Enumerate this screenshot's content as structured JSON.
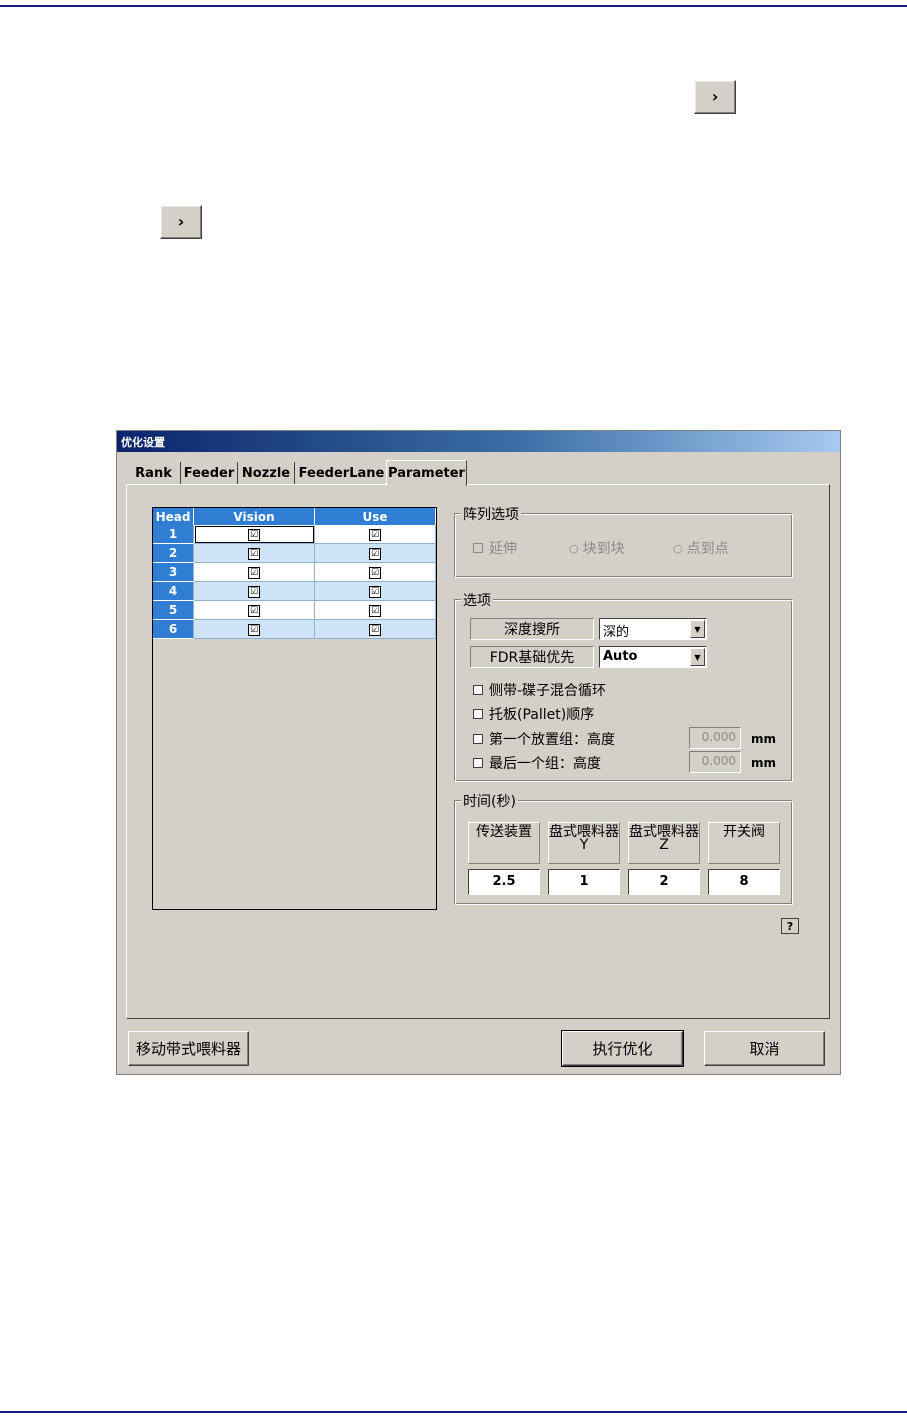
{
  "window": {
    "title": "优化设置"
  },
  "tabs": [
    "Rank",
    "Feeder",
    "Nozzle",
    "FeederLane",
    "Parameter"
  ],
  "active_tab": "Parameter",
  "head_table": {
    "columns": [
      "Head",
      "Vision",
      "Use"
    ],
    "rows": [
      {
        "head": "1",
        "vision": "☑",
        "use": "☑"
      },
      {
        "head": "2",
        "vision": "☑",
        "use": "☑"
      },
      {
        "head": "3",
        "vision": "☑",
        "use": "☑"
      },
      {
        "head": "4",
        "vision": "☑",
        "use": "☑"
      },
      {
        "head": "5",
        "vision": "☑",
        "use": "☑"
      },
      {
        "head": "6",
        "vision": "☑",
        "use": "☑"
      }
    ]
  },
  "array_options": {
    "title": "阵列选项",
    "extend": "延伸",
    "block_to_block": "块到块",
    "point_to_point": "点到点"
  },
  "options": {
    "title": "选项",
    "depth_search_label": "深度搜所",
    "depth_search_value": "深的",
    "fdr_priority_label": "FDR基础优先",
    "fdr_priority_value": "Auto",
    "mixed_loop": "侧带-碟子混合循环",
    "pallet_order": "托板(Pallet)顺序",
    "first_group_height": "第一个放置组：高度",
    "last_group_height": "最后一个组：高度",
    "first_height_value": "0.000",
    "last_height_value": "0.000",
    "unit": "mm"
  },
  "timing": {
    "title": "时间(秒)",
    "conveyor_label": "传送装置",
    "tray_y_label": "盘式喂料器Y",
    "tray_z_label": "盘式喂料器Z",
    "valve_label": "开关阀",
    "conveyor_value": "2.5",
    "tray_y_value": "1",
    "tray_z_value": "2",
    "valve_value": "8"
  },
  "help_label": "?",
  "buttons": {
    "move_feeder": "移动带式喂料器",
    "execute": "执行优化",
    "cancel": "取消"
  },
  "page_arrow_glyph": "›"
}
